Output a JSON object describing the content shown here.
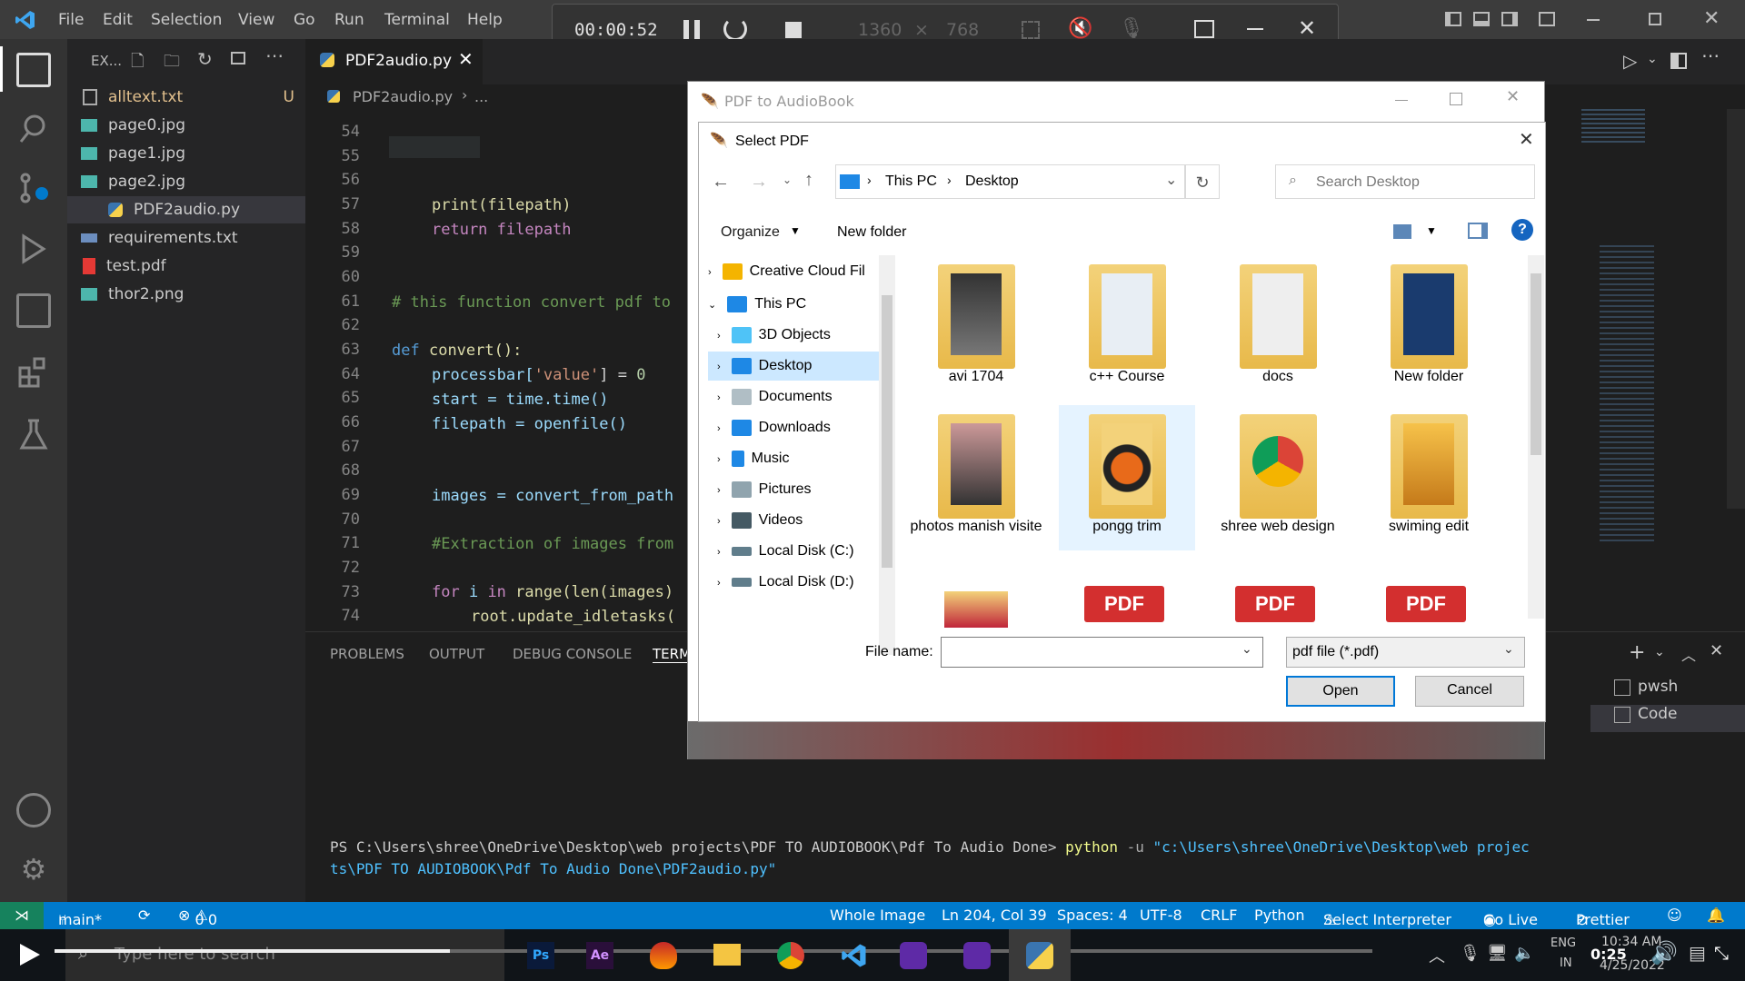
{
  "menu": [
    "File",
    "Edit",
    "Selection",
    "View",
    "Go",
    "Run",
    "Terminal",
    "Help"
  ],
  "recorder": {
    "time": "00:00:52",
    "width": "1360",
    "x": "×",
    "height": "768"
  },
  "explorer": {
    "header": "EX...",
    "files": [
      {
        "name": "alltext.txt",
        "badge": "U"
      },
      {
        "name": "page0.jpg"
      },
      {
        "name": "page1.jpg"
      },
      {
        "name": "page2.jpg"
      },
      {
        "name": "PDF2audio.py"
      },
      {
        "name": "requirements.txt"
      },
      {
        "name": "test.pdf"
      },
      {
        "name": "thor2.png"
      }
    ]
  },
  "editor": {
    "tab": "PDF2audio.py",
    "breadcrumb": "PDF2audio.py",
    "breadcrumb_more": "...",
    "lines": [
      "54",
      "55",
      "56",
      "57",
      "58",
      "59",
      "60",
      "61",
      "62",
      "63",
      "64",
      "65",
      "66",
      "67",
      "68",
      "69",
      "70",
      "71",
      "72",
      "73",
      "74"
    ],
    "code": {
      "l57": "print(filepath)",
      "l58": "return filepath",
      "l61": "# this function convert pdf to",
      "l63a": "def",
      "l63b": "convert():",
      "l64a": "processbar[",
      "l64b": "'value'",
      "l64c": "] = ",
      "l64d": "0",
      "l65": "start = time.time()",
      "l66": "filepath = openfile()",
      "l69": "images = convert_from_path",
      "l71": "#Extraction of images from",
      "l73a": "for",
      "l73b": " i ",
      "l73c": "in",
      "l73d": " range(len(images)",
      "l74": "root.update_idletasks("
    }
  },
  "panel": {
    "tabs": [
      "PROBLEMS",
      "OUTPUT",
      "DEBUG CONSOLE",
      "TERM"
    ],
    "terminal_prompt": "PS C:\\Users\\shree\\OneDrive\\Desktop\\web projects\\PDF TO AUDIOBOOK\\Pdf To Audio Done>",
    "terminal_cmd": "python",
    "terminal_flag": "-u",
    "terminal_path1": "\"c:\\Users\\shree\\OneDrive\\Desktop\\web projec",
    "terminal_path2": "ts\\PDF TO AUDIOBOOK\\Pdf To Audio Done\\PDF2audio.py\"",
    "shells": [
      "pwsh",
      "Code"
    ]
  },
  "statusbar": {
    "branch": "main*",
    "errors": "0",
    "warnings": "0",
    "items": [
      "Whole Image",
      "Ln 204, Col 39",
      "Spaces: 4",
      "UTF-8",
      "CRLF",
      "Python",
      "Select Interpreter",
      "Go Live",
      "Prettier"
    ]
  },
  "backwin": {
    "title": "PDF to AudioBook"
  },
  "dialog": {
    "title": "Select PDF",
    "path": [
      "This PC",
      "Desktop"
    ],
    "search_placeholder": "Search Desktop",
    "organize": "Organize",
    "new_folder": "New folder",
    "nav": [
      "Creative Cloud Fil",
      "This PC",
      "3D Objects",
      "Desktop",
      "Documents",
      "Downloads",
      "Music",
      "Pictures",
      "Videos",
      "Local Disk (C:)",
      "Local Disk (D:)"
    ],
    "folders": [
      {
        "name": "avi 1704"
      },
      {
        "name": "c++ Course"
      },
      {
        "name": "docs"
      },
      {
        "name": "New folder"
      },
      {
        "name": "photos manish visite"
      },
      {
        "name": "pongg trim"
      },
      {
        "name": "shree web design"
      },
      {
        "name": "swiming edit"
      }
    ],
    "pdf_label": "PDF",
    "file_name_label": "File name:",
    "file_name_value": "",
    "filter": "pdf file (*.pdf)",
    "open": "Open",
    "cancel": "Cancel"
  },
  "taskbar": {
    "search_placeholder": "Type here to search",
    "video_time": "0:25",
    "lang1": "ENG",
    "lang2": "IN",
    "clock_time": "10:34 AM",
    "clock_date": "4/25/2022"
  },
  "colors": {
    "accent": "#007acc",
    "activity": "#333333",
    "sidebar": "#252526",
    "editor": "#1e1e1e"
  }
}
